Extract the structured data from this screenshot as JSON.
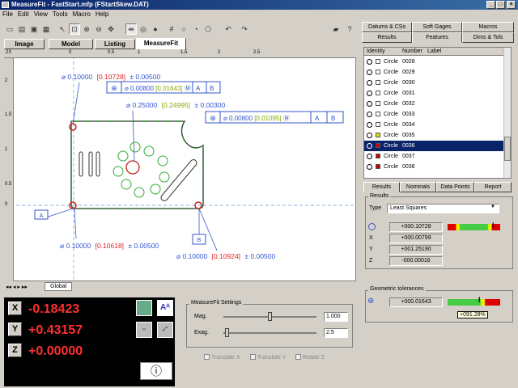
{
  "window": {
    "title": "MeasureFit - FastStart.mfp (FStartSkew.DAT)"
  },
  "menu": [
    "File",
    "Edit",
    "View",
    "Tools",
    "Macro",
    "Help"
  ],
  "view_tabs": [
    "Image",
    "Model",
    "Listing",
    "MeasureFit"
  ],
  "canvas": {
    "ruler_top_labels": [
      "0",
      "0.5",
      "1",
      "1.5",
      "2",
      "2.5"
    ],
    "ruler_left_labels": [
      "2",
      "1.5",
      "1",
      "0.5",
      "0"
    ],
    "corner_label": "2X",
    "annotations": {
      "top_dia": {
        "prefix": "⌀ 0.10000",
        "measured": "[0.10728]",
        "tol": "± 0.00500"
      },
      "top_fcf": {
        "value": "0.00800",
        "measured": "[0.01643]",
        "datums": [
          "A",
          "B"
        ]
      },
      "mid_dia": {
        "prefix": "⌀ 0.25000",
        "measured": "[0.24995]",
        "tol": "± 0.00300"
      },
      "mid_fcf": {
        "value": "0.00800",
        "measured": "[0.01095]",
        "datums": [
          "A",
          "B"
        ]
      },
      "bl_dia": {
        "prefix": "⌀ 0.10000",
        "measured": "[0.10618]",
        "tol": "± 0.00500"
      },
      "br_dia": {
        "prefix": "⌀ 0.10000",
        "measured": "[0.10924]",
        "tol": "± 0.00500"
      },
      "datum_a": "A",
      "datum_b": "B"
    },
    "bottom_tab": "Global"
  },
  "readout": {
    "x_label": "X",
    "x_value": "-0.18423",
    "y_label": "Y",
    "y_value": "+0.43157",
    "z_label": "Z",
    "z_value": "+0.00000"
  },
  "settings": {
    "title": "MeasureFit Settings",
    "mag_label": "Mag.",
    "mag_value": "1.000",
    "exag_label": "Exag.",
    "exag_value": "2.5",
    "translate_x": "Translate X",
    "translate_y": "Translate Y",
    "rotate_z": "Rotate Z"
  },
  "right_tabs_top": [
    "Datums & CSs",
    "Soft Gages",
    "Macros"
  ],
  "right_tabs_bottom": [
    "Results",
    "Features",
    "Dims & Tols"
  ],
  "feature_list": {
    "columns": [
      "Identity",
      "Number",
      "Label"
    ],
    "rows": [
      {
        "type": "Circle",
        "number": "0028",
        "color": "#ffffff"
      },
      {
        "type": "Circle",
        "number": "0029",
        "color": "#ffffff"
      },
      {
        "type": "Circle",
        "number": "0030",
        "color": "#ffffff"
      },
      {
        "type": "Circle",
        "number": "0031",
        "color": "#ffffff"
      },
      {
        "type": "Circle",
        "number": "0032",
        "color": "#ffffff"
      },
      {
        "type": "Circle",
        "number": "0033",
        "color": "#ffffff"
      },
      {
        "type": "Circle",
        "number": "0034",
        "color": "#ffffff"
      },
      {
        "type": "Circle",
        "number": "0035",
        "color": "#e0e000"
      },
      {
        "type": "Circle",
        "number": "0036",
        "color": "#cc0000",
        "selected": true
      },
      {
        "type": "Circle",
        "number": "0037",
        "color": "#cc0000"
      },
      {
        "type": "Circle",
        "number": "0038",
        "color": "#cc0000"
      }
    ]
  },
  "result_tabs": [
    "Results",
    "Nominals",
    "Data Points",
    "Report"
  ],
  "results": {
    "group_label": "Results",
    "type_label": "Type",
    "type_value": "Least Squares",
    "diameter_value": "+000.10728",
    "x_label": "X",
    "x_value": "+000.00799",
    "y_label": "Y",
    "y_value": "+001.25190",
    "z_label": "Z",
    "z_value": "-000.00016"
  },
  "geo_tol": {
    "group_label": "Geometric tolerances",
    "value": "+000.01643",
    "percent": "+091.28%"
  },
  "colors": {
    "accent": "#0a246a",
    "readout_red": "#ff3030",
    "annotation_blue": "#3355cc",
    "measured_red": "#dd2222",
    "measured_green": "#88aa00"
  }
}
